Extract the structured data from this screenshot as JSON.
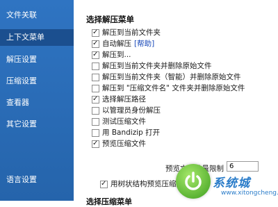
{
  "sidebar": {
    "items": [
      {
        "label": "文件关联",
        "active": false
      },
      {
        "label": "上下文菜单",
        "active": true
      },
      {
        "label": "解压设置",
        "active": false
      },
      {
        "label": "压缩设置",
        "active": false
      },
      {
        "label": "查看器",
        "active": false
      },
      {
        "label": "其它设置",
        "active": false
      }
    ],
    "bottom_item": "语言设置"
  },
  "main": {
    "section_title": "选择解压菜单",
    "options": [
      {
        "label": "解压到当前文件夹",
        "checked": true
      },
      {
        "label": "自动解压",
        "checked": true,
        "link": "[帮助]"
      },
      {
        "label": "解压到...",
        "checked": true
      },
      {
        "label": "解压到当前文件夹并删除原始文件",
        "checked": false
      },
      {
        "label": "解压到当前文件夹（智能）并删除原始文件",
        "checked": false
      },
      {
        "label": "解压到 \"压缩文件名\" 文件夹并删除原始文件",
        "checked": false
      },
      {
        "label": "选择解压路径",
        "checked": true
      },
      {
        "label": "以管理员身份解压",
        "checked": false
      },
      {
        "label": "测试压缩文件",
        "checked": false
      },
      {
        "label": "用 Bandizip 打开",
        "checked": false
      },
      {
        "label": "预览压缩文件",
        "checked": true
      }
    ],
    "preview_limit_label": "预览文件数量限制",
    "preview_limit_value": "6",
    "tree_option": {
      "label": "用树状结构预览压缩文件",
      "checked": true
    },
    "next_section_title": "选择压缩菜单"
  },
  "watermark": {
    "text": "系统城",
    "url": "www.xitongcheng.com"
  },
  "colors": {
    "sidebar_bg": "#2f74c2",
    "sidebar_active": "#1b4f8f",
    "link": "#1747b8",
    "watermark": "#2a7cc9"
  }
}
